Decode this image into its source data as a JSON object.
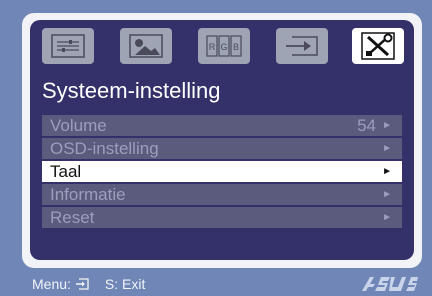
{
  "header": {
    "title": "Systeem-instelling"
  },
  "tabs": [
    {
      "icon": "sliders-icon"
    },
    {
      "icon": "image-icon"
    },
    {
      "icon": "rgb-icon",
      "label": "R G B"
    },
    {
      "icon": "input-icon"
    },
    {
      "icon": "tools-icon",
      "active": true
    }
  ],
  "menu": {
    "items": [
      {
        "label": "Volume",
        "value": "54",
        "arrow": "►"
      },
      {
        "label": "OSD-instelling",
        "value": "",
        "arrow": "►"
      },
      {
        "label": "Taal",
        "value": "",
        "arrow": "►",
        "selected": true
      },
      {
        "label": "Informatie",
        "value": "",
        "arrow": "►"
      },
      {
        "label": "Reset",
        "value": "",
        "arrow": "►"
      }
    ]
  },
  "footer": {
    "menu_label": "Menu:",
    "exit_label": "S: Exit",
    "brand": "ASUS"
  },
  "colors": {
    "background": "#6f86b6",
    "panel": "#33306a",
    "row": "#5b5b7e",
    "selected_row": "#ffffff"
  }
}
